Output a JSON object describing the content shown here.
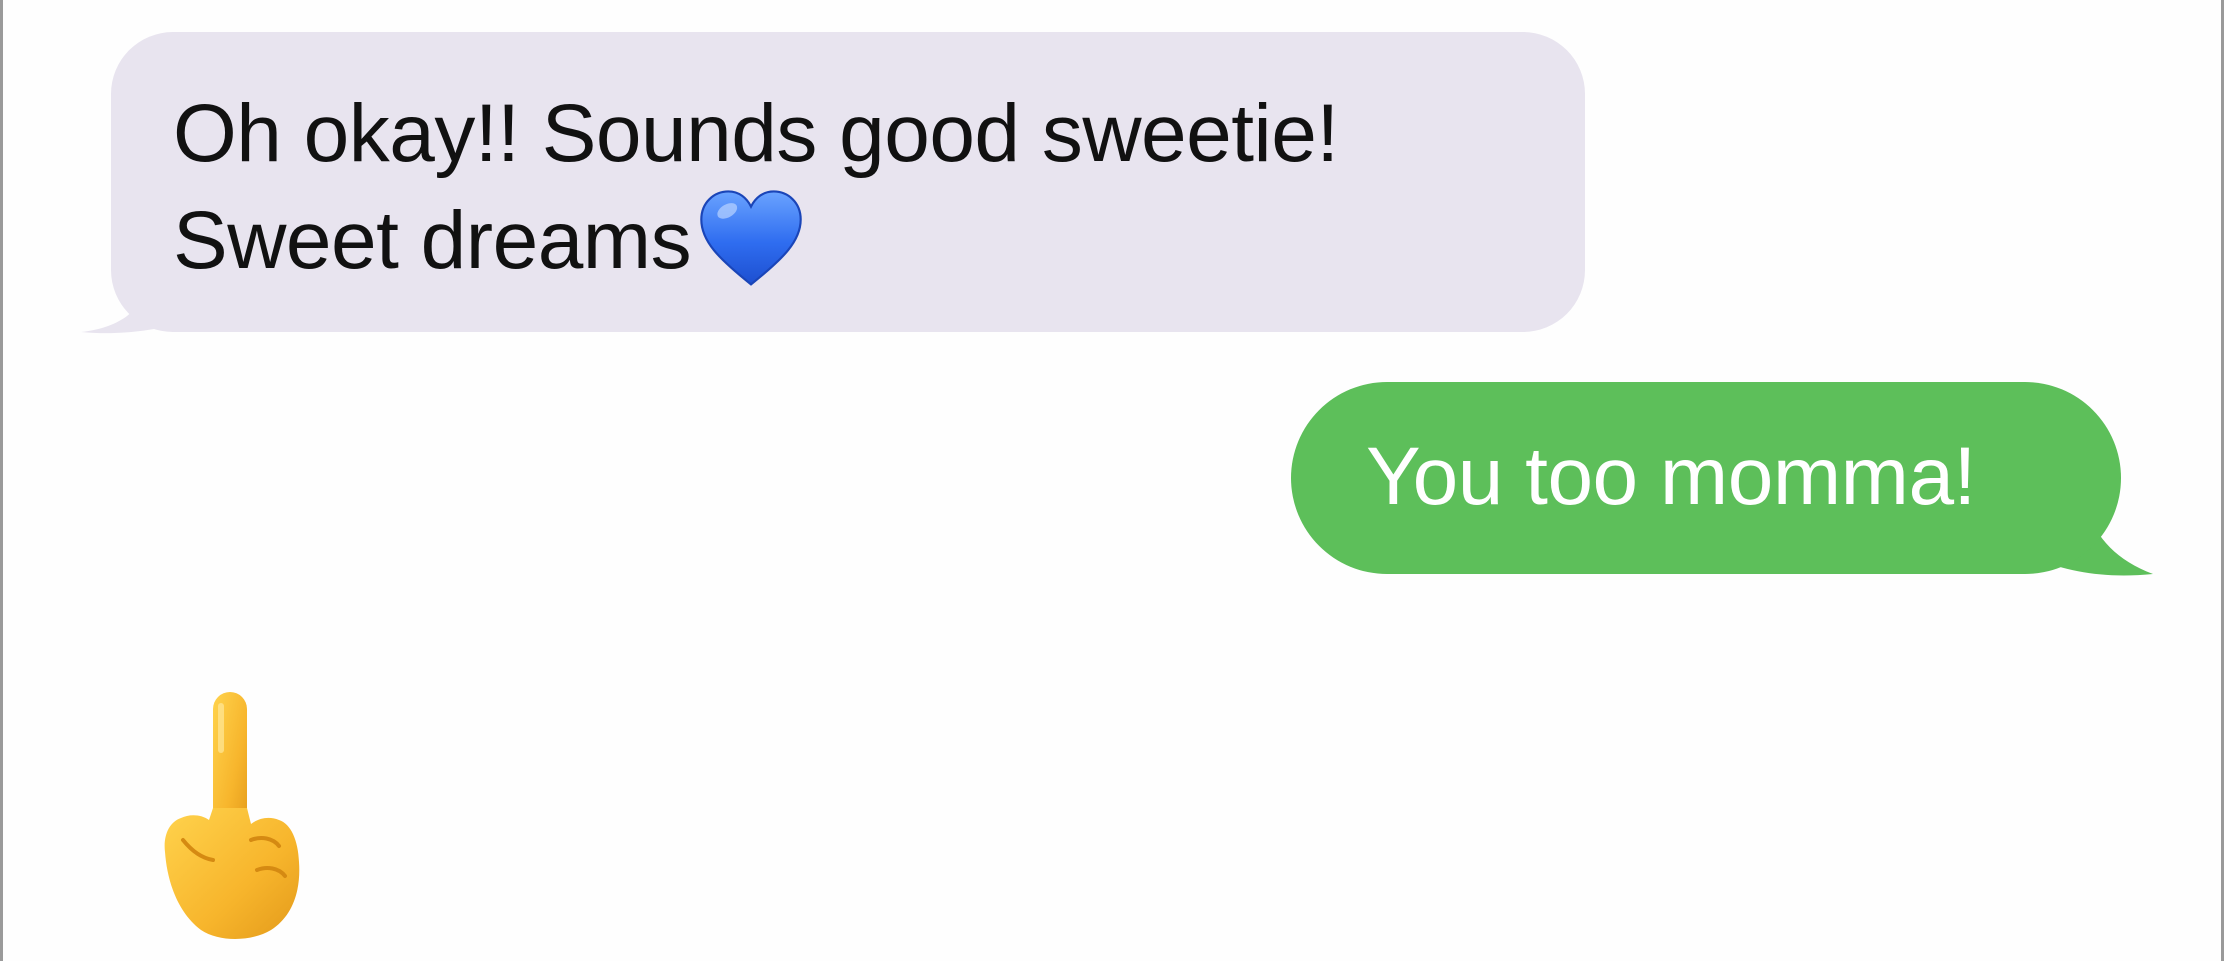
{
  "messages": [
    {
      "direction": "incoming",
      "line1": "Oh okay!! Sounds good sweetie!",
      "line2": "Sweet dreams",
      "emoji": "blue-heart",
      "bubble_color": "#e8e4ef",
      "text_color": "#111111"
    },
    {
      "direction": "outgoing",
      "text": "You too momma!",
      "bubble_color": "#5dbf5a",
      "text_color": "#ffffff"
    },
    {
      "direction": "incoming",
      "emoji": "middle-finger",
      "emoji_only": true
    }
  ]
}
